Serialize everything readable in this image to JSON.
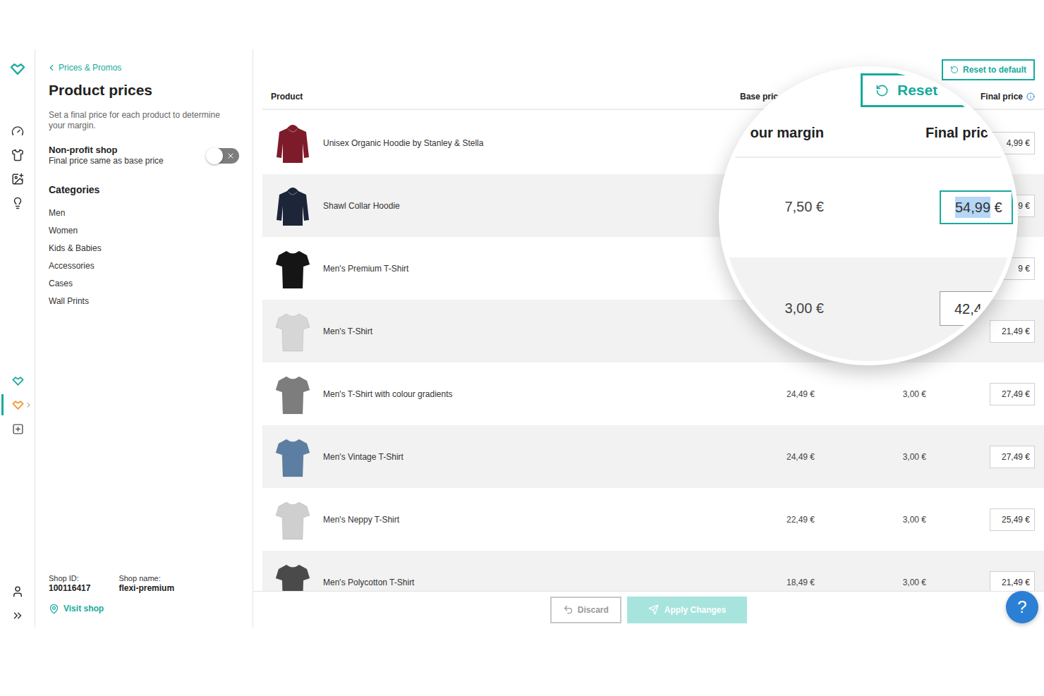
{
  "rail": {
    "top": [
      {
        "selected": false
      },
      {
        "selected": false
      },
      {
        "selected": false
      },
      {
        "selected": false
      }
    ],
    "shops": [
      {
        "selected": false
      },
      {
        "selected": true
      },
      {
        "selected": false
      }
    ],
    "bottom": [
      {
        "selected": false
      },
      {
        "selected": false
      }
    ]
  },
  "sidebar": {
    "back_link": "Prices & Promos",
    "title": "Product prices",
    "description": "Set a final price for each product to determine your margin.",
    "non_profit": {
      "label": "Non-profit shop",
      "hint": "Final price same as base price",
      "on": false
    },
    "categories": {
      "title": "Categories",
      "items": [
        {
          "label": "Men",
          "selected": false
        },
        {
          "label": "Women",
          "selected": false
        },
        {
          "label": "Kids & Babies",
          "selected": false
        },
        {
          "label": "Accessories",
          "selected": false
        },
        {
          "label": "Cases",
          "selected": false
        },
        {
          "label": "Wall Prints",
          "selected": false
        }
      ]
    },
    "shop": {
      "id_label": "Shop ID:",
      "id": "100116417",
      "name_label": "Shop name:",
      "name": "flexi-premium"
    },
    "visit_shop": "Visit shop"
  },
  "main": {
    "reset_button": "Reset to default",
    "table": {
      "columns": [
        {
          "label": "Product"
        },
        {
          "label": "Base pric"
        },
        {
          "label": "Final price"
        }
      ],
      "rows": [
        {
          "name": "Unisex Organic Hoodie by Stanley & Stella",
          "kind": "hoodie",
          "color": "#7e1b2a",
          "final_price": "4,99 €"
        },
        {
          "name": "Shawl Collar Hoodie",
          "kind": "hoodie",
          "color": "#1d2638",
          "final_price": "9 €"
        },
        {
          "name": "Men's Premium T-Shirt",
          "kind": "tshirt",
          "color": "#151515",
          "final_price": "9 €"
        },
        {
          "name": "Men's T-Shirt",
          "kind": "tshirt",
          "color": "#d6d6d6",
          "final_price": "21,49 €"
        },
        {
          "name": "Men's T-Shirt with colour gradients",
          "kind": "tshirt",
          "color": "#7d7d7d",
          "base_price": "24,49 €",
          "margin": "3,00 €",
          "final_price": "27,49 €"
        },
        {
          "name": "Men's Vintage T-Shirt",
          "kind": "tshirt",
          "color": "#5d7ea3",
          "base_price": "24,49 €",
          "margin": "3,00 €",
          "final_price": "27,49 €"
        },
        {
          "name": "Men's Neppy T-Shirt",
          "kind": "tshirt",
          "color": "#cfcfcf",
          "base_price": "22,49 €",
          "margin": "3,00 €",
          "final_price": "25,49 €"
        },
        {
          "name": "Men's Polycotton T-Shirt",
          "kind": "tshirt",
          "color": "#4a4a4a",
          "base_price": "18,49 €",
          "margin": "3,00 €",
          "final_price": "21,49 €"
        }
      ]
    },
    "buttons": [
      {
        "label": "Discard",
        "kind": "secondary",
        "disabled": true
      },
      {
        "label": "Apply Changes",
        "kind": "primary",
        "disabled": true
      }
    ],
    "help": "?"
  },
  "magnifier": {
    "reset_label": "Reset",
    "columns": [
      "our margin",
      "Final pric"
    ],
    "rows": [
      {
        "margin": "7,50 €",
        "value_selected": "54,99",
        "value": " €",
        "focused": true
      },
      {
        "margin": "3,00 €",
        "value_selected": "",
        "value": "42,4",
        "focused": false
      }
    ]
  }
}
